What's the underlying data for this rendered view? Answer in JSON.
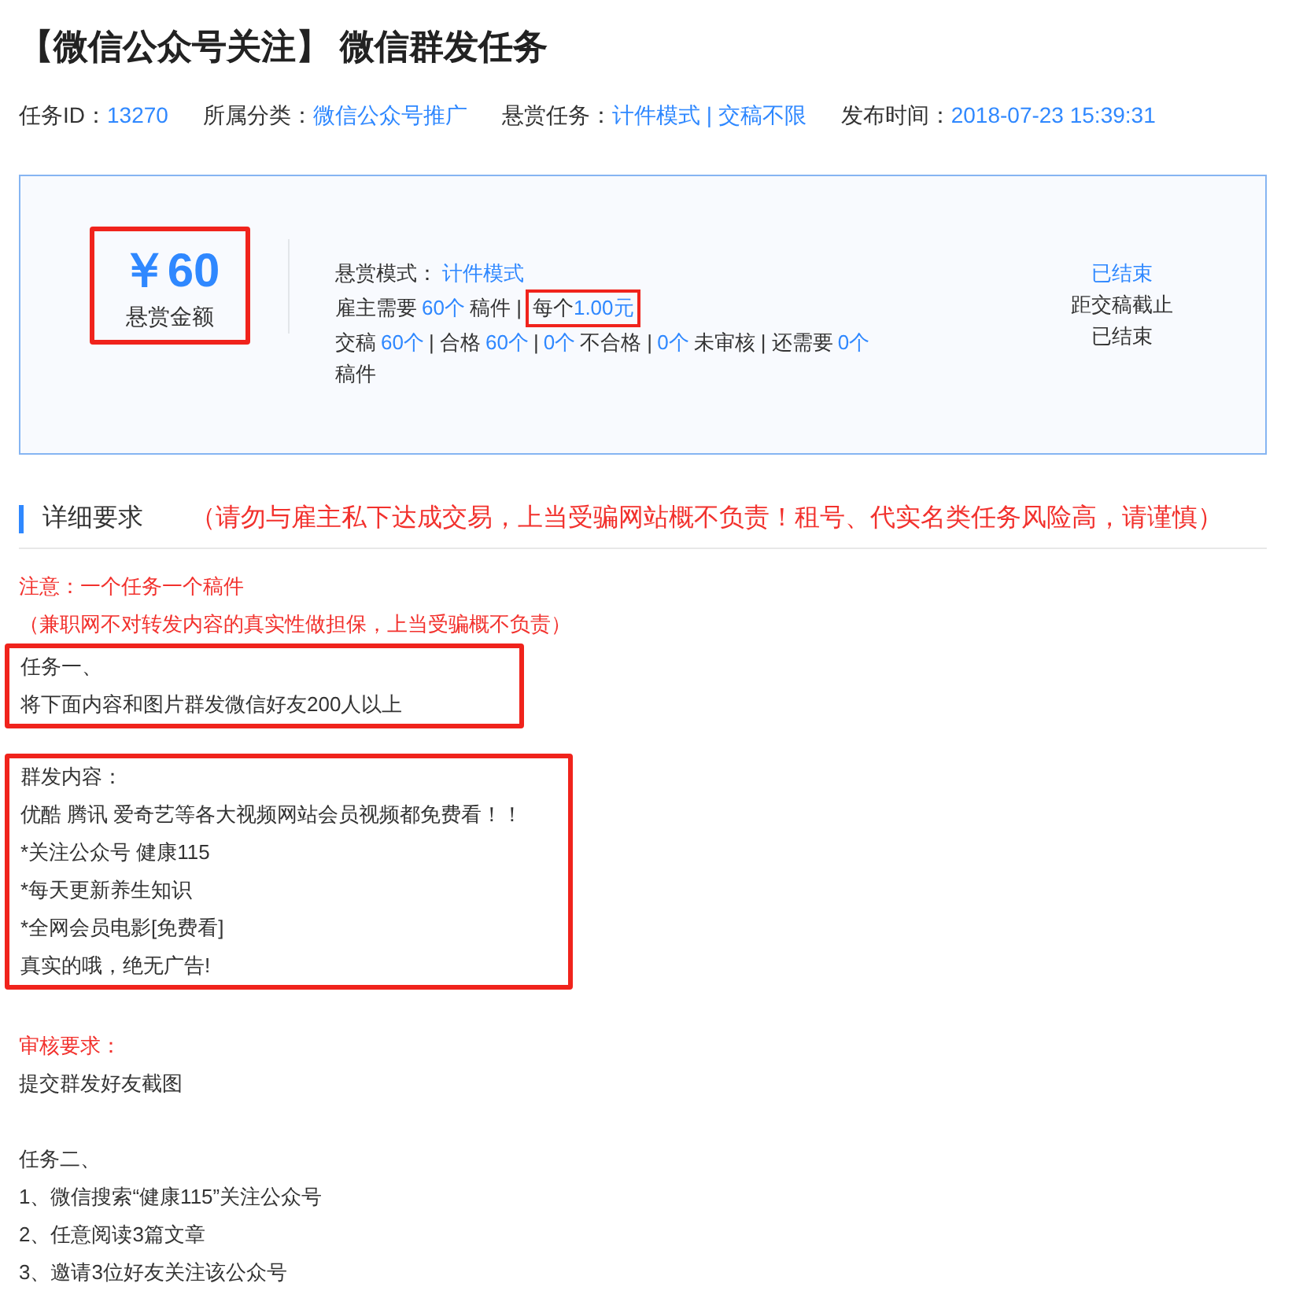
{
  "title": "【微信公众号关注】 微信群发任务",
  "meta": [
    {
      "label": "任务ID：",
      "value": "13270"
    },
    {
      "label": "所属分类：",
      "value": "微信公众号推广"
    },
    {
      "label": "悬赏任务：",
      "value": "计件模式 | 交稿不限"
    },
    {
      "label": "发布时间：",
      "value": "2018-07-23 15:39:31"
    }
  ],
  "reward": {
    "amount": "￥60",
    "label": "悬赏金额",
    "highlighted": true
  },
  "info_lines": [
    [
      {
        "text": "悬赏模式：",
        "kind": "plain",
        "boxed": false
      },
      {
        "text": "计件模式",
        "kind": "link",
        "boxed": false
      }
    ],
    [
      {
        "text": "雇主需要",
        "kind": "plain",
        "boxed": false
      },
      {
        "text": "60个",
        "kind": "link",
        "boxed": false
      },
      {
        "text": "稿件 |",
        "kind": "plain",
        "boxed": false
      },
      {
        "text": "每个",
        "kind": "plain",
        "boxed": true
      },
      {
        "text": "1.00元",
        "kind": "link",
        "boxed": true
      }
    ],
    [
      {
        "text": "交稿",
        "kind": "plain",
        "boxed": false
      },
      {
        "text": "60个",
        "kind": "link",
        "boxed": false
      },
      {
        "text": "| 合格",
        "kind": "plain",
        "boxed": false
      },
      {
        "text": "60个",
        "kind": "link",
        "boxed": false
      },
      {
        "text": "|",
        "kind": "plain",
        "boxed": false
      },
      {
        "text": "0个",
        "kind": "link",
        "boxed": false
      },
      {
        "text": "不合格 |",
        "kind": "plain",
        "boxed": false
      },
      {
        "text": "0个",
        "kind": "link",
        "boxed": false
      },
      {
        "text": "未审核 | 还需要",
        "kind": "plain",
        "boxed": false
      },
      {
        "text": "0个",
        "kind": "link",
        "boxed": false
      }
    ],
    [
      {
        "text": "稿件",
        "kind": "plain",
        "boxed": false
      }
    ]
  ],
  "status": [
    {
      "text": "已结束",
      "kind": "link"
    },
    {
      "text": "距交稿截止",
      "kind": "plain"
    },
    {
      "text": "已结束",
      "kind": "plain"
    }
  ],
  "section": {
    "heading": "详细要求",
    "warning": "（请勿与雇主私下达成交易，上当受骗网站概不负责！租号、代实名类任务风险高，请谨慎）"
  },
  "blocks": [
    {
      "highlighted": false,
      "lines": [
        {
          "text": "注意：一个任务一个稿件",
          "kind": "warning"
        },
        {
          "text": "（兼职网不对转发内容的真实性做担保，上当受骗概不负责）",
          "kind": "warning"
        }
      ]
    },
    {
      "highlighted": true,
      "lines": [
        {
          "text": "任务一、",
          "kind": "plain"
        },
        {
          "text": "将下面内容和图片群发微信好友200人以上",
          "kind": "plain"
        }
      ]
    },
    {
      "highlighted": true,
      "lines": [
        {
          "text": "群发内容：",
          "kind": "plain"
        },
        {
          "text": "优酷 腾讯 爱奇艺等各大视频网站会员视频都免费看！！",
          "kind": "plain"
        },
        {
          "text": "*关注公众号 健康115",
          "kind": "plain"
        },
        {
          "text": "*每天更新养生知识",
          "kind": "plain"
        },
        {
          "text": "*全网会员电影[免费看]",
          "kind": "plain"
        },
        {
          "text": "真实的哦，绝无广告!",
          "kind": "plain"
        }
      ]
    },
    {
      "highlighted": false,
      "lines": [
        {
          "text": "审核要求：",
          "kind": "warning"
        },
        {
          "text": "提交群发好友截图",
          "kind": "plain"
        }
      ]
    },
    {
      "highlighted": false,
      "lines": [
        {
          "text": "任务二、",
          "kind": "plain"
        },
        {
          "text": "1、微信搜索“健康115”关注公众号",
          "kind": "plain"
        },
        {
          "text": "2、任意阅读3篇文章",
          "kind": "plain"
        },
        {
          "text": "3、邀请3位好友关注该公众号",
          "kind": "plain"
        }
      ]
    }
  ]
}
